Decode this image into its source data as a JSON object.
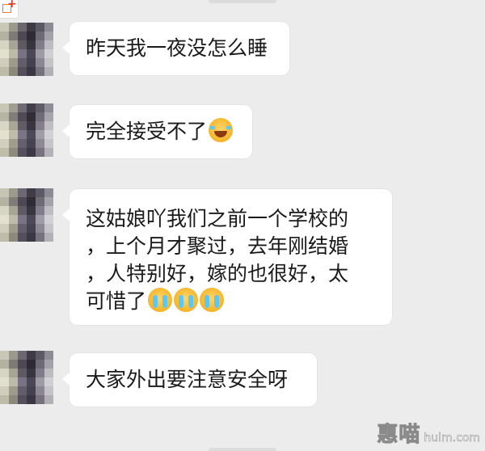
{
  "messages": [
    {
      "lines": [
        "昨天我一夜没怎么睡"
      ],
      "emoji": []
    },
    {
      "lines": [
        "完全接受不了"
      ],
      "emoji": [
        "laugh-cry-emoji"
      ]
    },
    {
      "lines": [
        "这姑娘吖我们之前一个学校的",
        "，上个月才聚过，去年刚结婚",
        "，人特别好，嫁的也很好，太",
        "可惜了"
      ],
      "emoji": [
        "crying-emoji",
        "crying-emoji",
        "crying-emoji"
      ]
    },
    {
      "lines": [
        "大家外出要注意安全呀"
      ],
      "emoji": []
    }
  ],
  "watermark": {
    "brand": "惠喵",
    "domain": "huim.com"
  },
  "colors": {
    "background": "#ececec",
    "bubble": "#ffffff",
    "text": "#1a1a1a",
    "accent": "#e57c2e"
  }
}
